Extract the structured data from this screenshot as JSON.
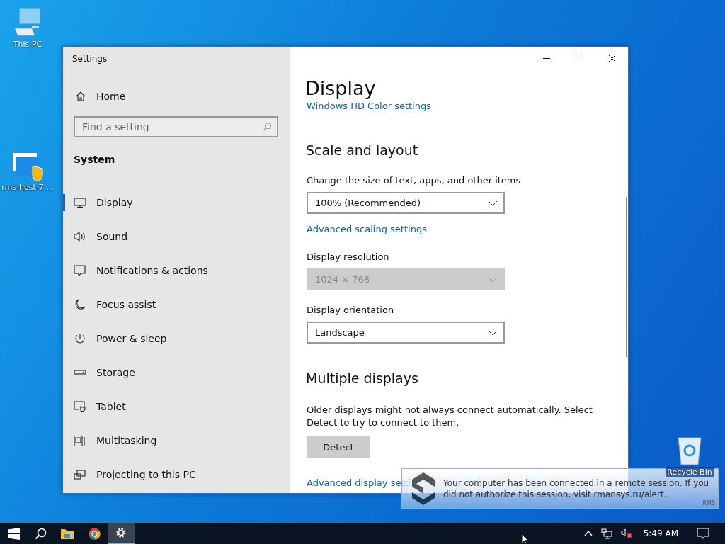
{
  "desktop_icons": [
    {
      "label": "This PC",
      "kind": "pc"
    },
    {
      "label": "rms-host-7....",
      "kind": "shortcut"
    },
    {
      "label": "Recycle Bin",
      "kind": "bin"
    }
  ],
  "window": {
    "title": "Settings"
  },
  "sidebar": {
    "home": "Home",
    "search": {
      "placeholder": "Find a setting"
    },
    "section": "System",
    "items": [
      {
        "label": "Display",
        "kind": "display",
        "selected": true
      },
      {
        "label": "Sound",
        "kind": "sound",
        "selected": false
      },
      {
        "label": "Notifications & actions",
        "kind": "notifications",
        "selected": false
      },
      {
        "label": "Focus assist",
        "kind": "moon",
        "selected": false
      },
      {
        "label": "Power & sleep",
        "kind": "power",
        "selected": false
      },
      {
        "label": "Storage",
        "kind": "storage",
        "selected": false
      },
      {
        "label": "Tablet",
        "kind": "tablet",
        "selected": false
      },
      {
        "label": "Multitasking",
        "kind": "multitasking",
        "selected": false
      },
      {
        "label": "Projecting to this PC",
        "kind": "projecting",
        "selected": false
      }
    ]
  },
  "content": {
    "title": "Display",
    "blocks": [
      {
        "kind": "link",
        "text": "Windows HD Color settings"
      },
      {
        "kind": "heading",
        "text": "Scale and layout"
      },
      {
        "kind": "label",
        "text": "Change the size of text, apps, and other items"
      },
      {
        "kind": "dropdown",
        "text": "100% (Recommended)",
        "disabled": false
      },
      {
        "kind": "link",
        "text": "Advanced scaling settings"
      },
      {
        "kind": "label",
        "text": "Display resolution"
      },
      {
        "kind": "dropdown",
        "text": "1024 × 768",
        "disabled": true
      },
      {
        "kind": "label",
        "text": "Display orientation"
      },
      {
        "kind": "dropdown",
        "text": "Landscape",
        "disabled": false
      },
      {
        "kind": "heading",
        "text": "Multiple displays"
      },
      {
        "kind": "paragraph",
        "text": "Older displays might not always connect automatically. Select Detect to try to connect to them."
      },
      {
        "kind": "button",
        "text": "Detect"
      },
      {
        "kind": "link",
        "text": "Advanced display setti"
      }
    ]
  },
  "notification": {
    "message": "Your computer has been connected in a remote session. If you did not authorize this session, visit rmansys.ru/alert.",
    "brand": "RMS"
  },
  "taskbar": {
    "apps": [
      {
        "kind": "start",
        "selected": false
      },
      {
        "kind": "search",
        "selected": false
      },
      {
        "kind": "folder",
        "selected": false
      },
      {
        "kind": "browser",
        "selected": false
      },
      {
        "kind": "settings",
        "selected": true
      }
    ],
    "time": "5:49 AM"
  }
}
